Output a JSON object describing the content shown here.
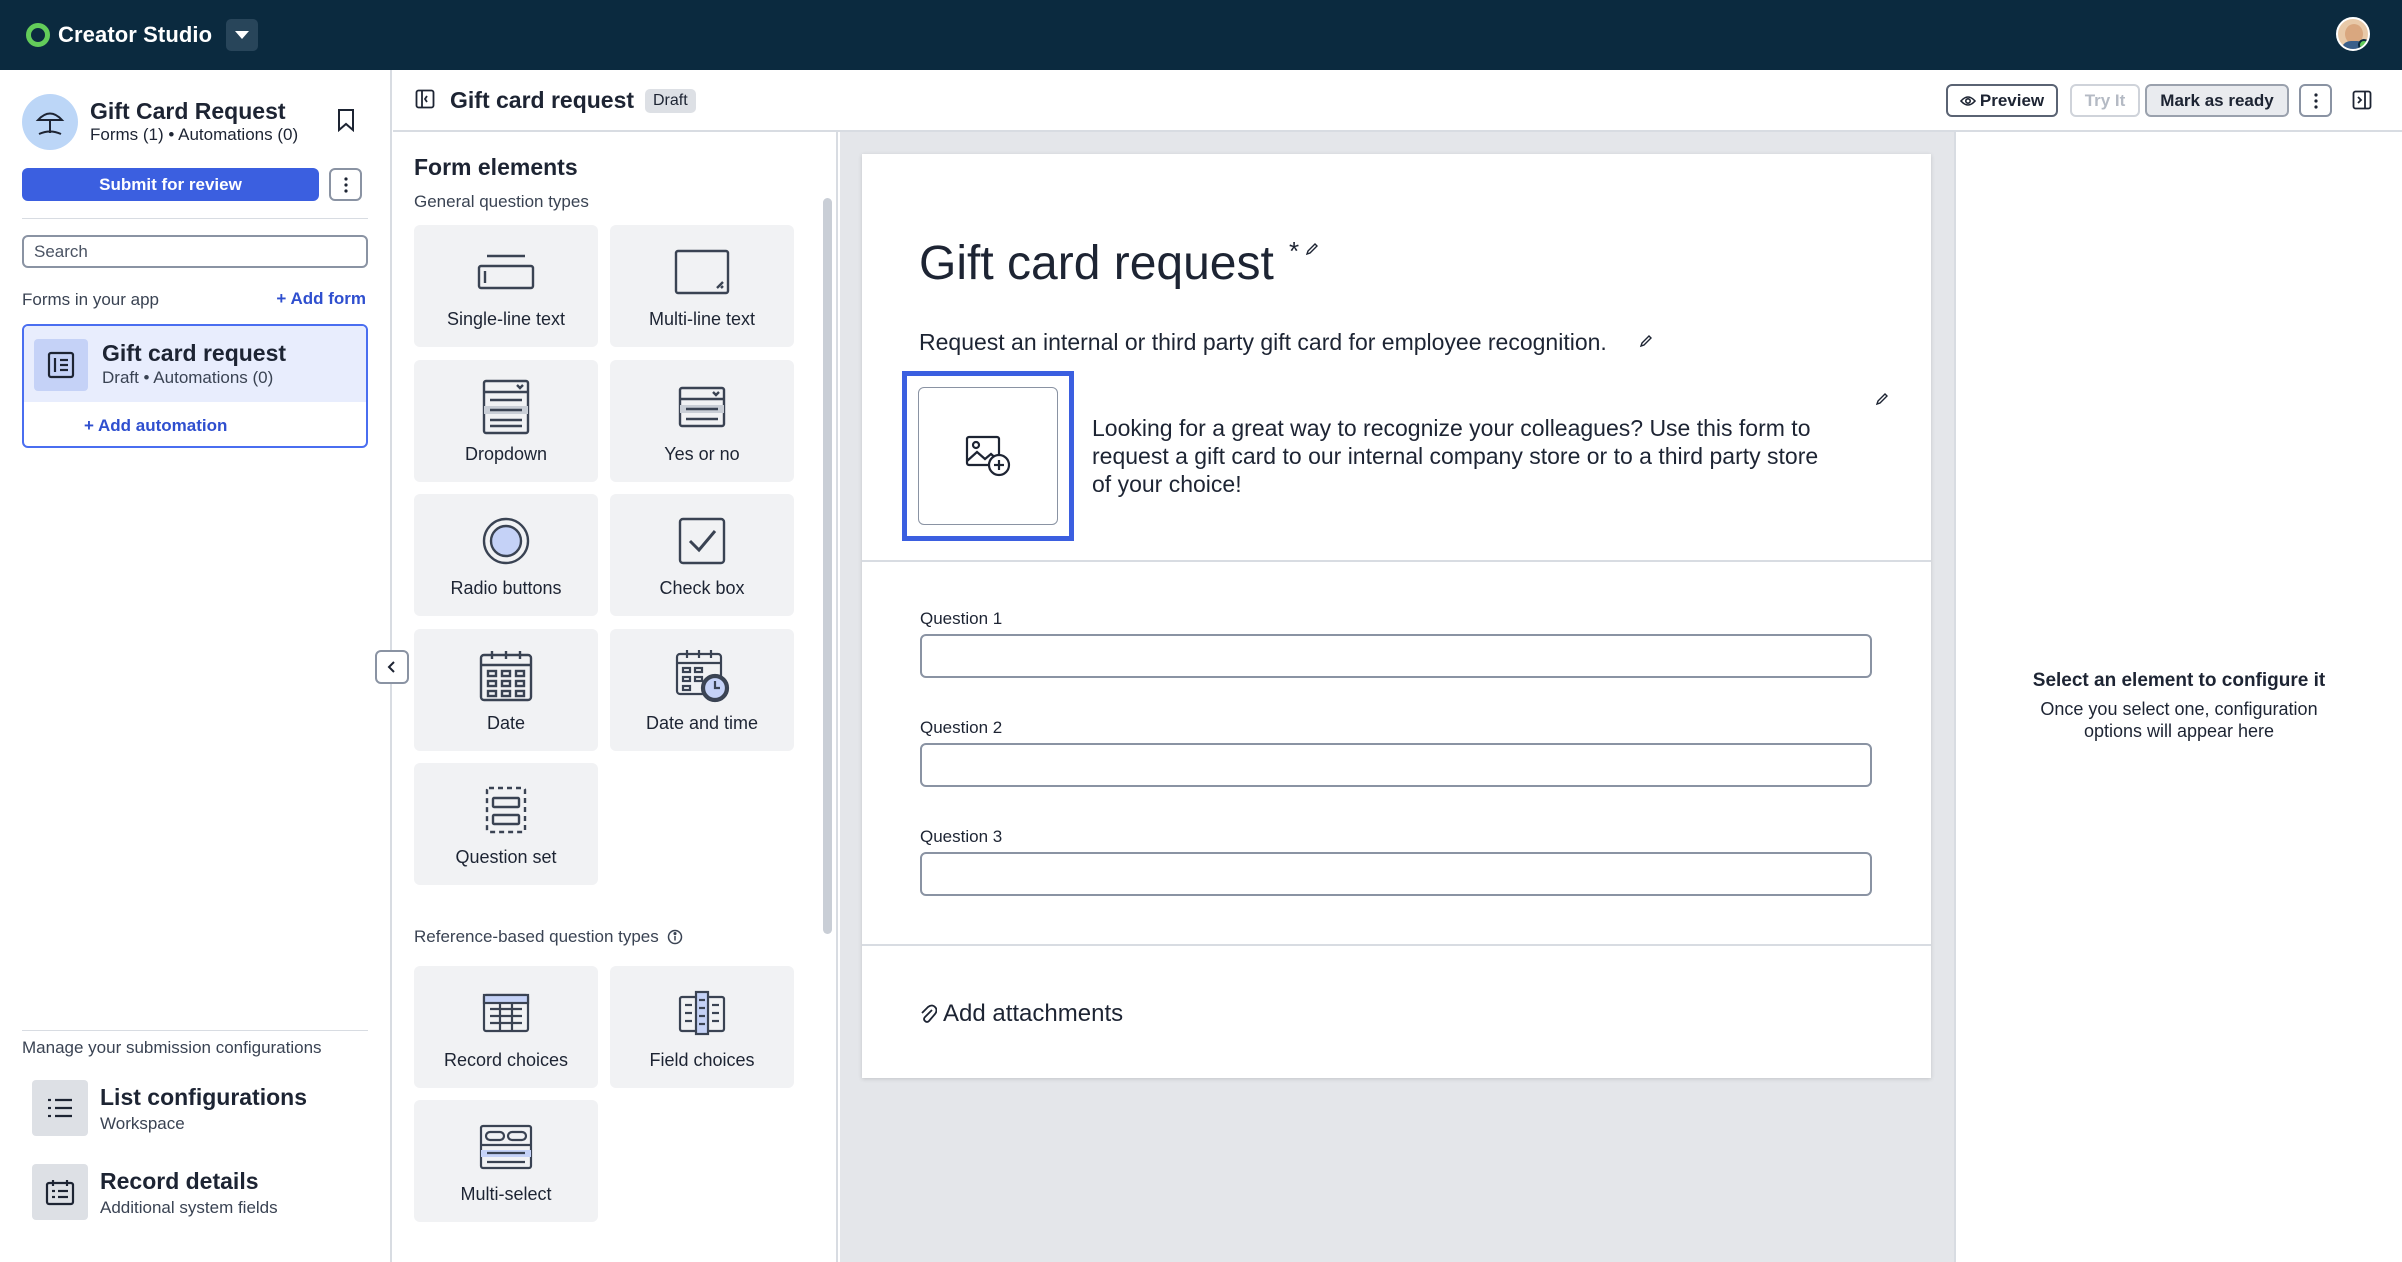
{
  "topbar": {
    "app_name": "Creator Studio"
  },
  "sidebar": {
    "app_title": "Gift Card Request",
    "app_subtitle": "Forms (1) • Automations (0)",
    "submit_label": "Submit for review",
    "search_placeholder": "Search",
    "forms_label": "Forms in your app",
    "add_form_label": "+ Add form",
    "form_card": {
      "title": "Gift card request",
      "subtitle": "Draft • Automations (0)",
      "add_automation": "+ Add automation"
    },
    "manage_label": "Manage your submission configurations",
    "configs": [
      {
        "title": "List configurations",
        "subtitle": "Workspace"
      },
      {
        "title": "Record details",
        "subtitle": "Additional system fields"
      }
    ]
  },
  "header": {
    "title": "Gift card request",
    "badge": "Draft",
    "preview_label": "Preview",
    "tryit_label": "Try It",
    "ready_label": "Mark as ready"
  },
  "elements": {
    "title": "Form elements",
    "general_label": "General question types",
    "general": [
      "Single-line text",
      "Multi-line text",
      "Dropdown",
      "Yes or no",
      "Radio buttons",
      "Check box",
      "Date",
      "Date and time",
      "Question set"
    ],
    "reference_label": "Reference-based question types",
    "reference": [
      "Record choices",
      "Field choices",
      "Multi-select"
    ]
  },
  "form": {
    "title": "Gift card request",
    "required_mark": "*",
    "description": "Request an internal or third party gift card for employee recognition.",
    "intro": "Looking for a great way to recognize your colleagues? Use this form to request a gift card to our internal company store or to a third party store of your choice!",
    "questions": [
      "Question 1",
      "Question 2",
      "Question 3"
    ],
    "attach_label": "Add attachments"
  },
  "config": {
    "heading": "Select an element to configure it",
    "body": "Once you select one, configuration options will appear here"
  },
  "colors": {
    "topbar": "#0b2a3f",
    "accent": "#3b5fe0",
    "brand": "#63cc5a"
  }
}
